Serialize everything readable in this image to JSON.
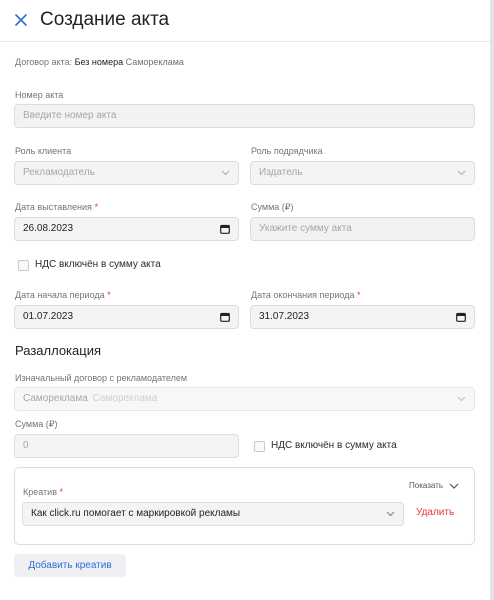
{
  "header": {
    "title": "Создание акта"
  },
  "contract": {
    "label": "Договор акта:",
    "number": "Без номера",
    "type": "Самореклама"
  },
  "act_number": {
    "label": "Номер акта",
    "placeholder": "Введите номер акта"
  },
  "client_role": {
    "label": "Роль клиента",
    "value": "Рекламодатель"
  },
  "contractor_role": {
    "label": "Роль подрядчика",
    "value": "Издатель"
  },
  "issue_date": {
    "label": "Дата выставления",
    "required": "*",
    "value": "26.08.2023"
  },
  "amount": {
    "label": "Сумма (₽)",
    "placeholder": "Укажите сумму акта"
  },
  "vat_checkbox": {
    "label": "НДС включён в сумму акта",
    "checked": false
  },
  "period_start": {
    "label": "Дата начала периода",
    "required": "*",
    "value": "01.07.2023"
  },
  "period_end": {
    "label": "Дата окончания периода",
    "required": "*",
    "value": "31.07.2023"
  },
  "reallocation": {
    "title": "Разаллокация",
    "contract_label": "Изначальный договор с рекламодателем",
    "contract_value": "Самореклама",
    "contract_sub": "Самореклама",
    "amount_label": "Сумма (₽)",
    "amount_value": "0",
    "vat_label": "НДС включён в сумму акта"
  },
  "creative": {
    "label": "Креатив",
    "required": "*",
    "show_label": "Показать",
    "value": "Как click.ru помогает с маркировкой рекламы",
    "delete_label": "Удалить"
  },
  "add_creative": {
    "label": "Добавить креатив"
  },
  "colors": {
    "accent": "#2f6fd1",
    "danger": "#e53935"
  }
}
